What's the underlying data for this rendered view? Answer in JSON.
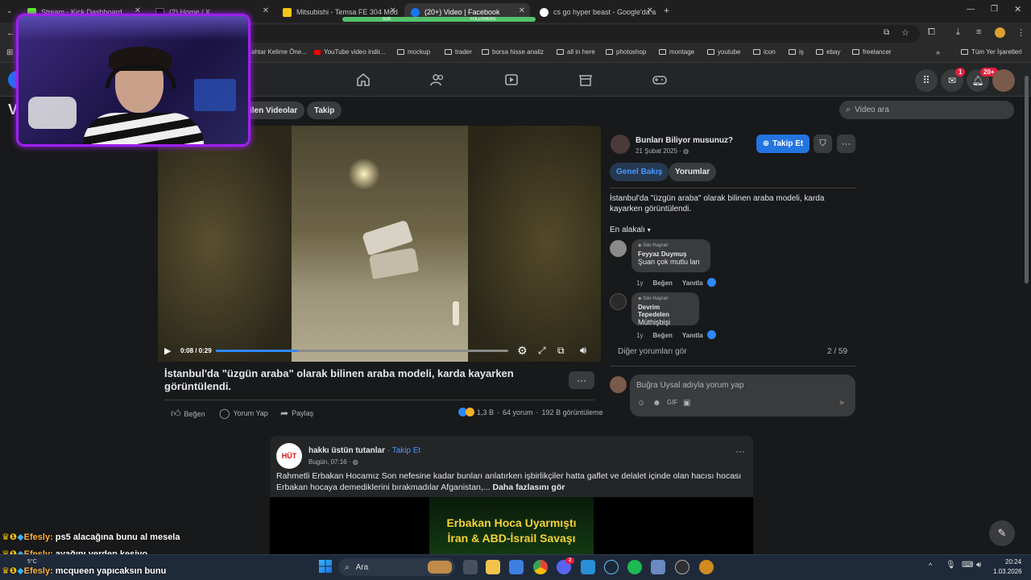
{
  "browser": {
    "tabs": [
      {
        "title": "Stream - Kick Dashboard",
        "favicon_color": "#53fc18"
      },
      {
        "title": "(2) Home / X",
        "favicon_color": "#000000"
      },
      {
        "title": "Mitsubishi - Temsa FE 304 Mod",
        "favicon_color": "#f5c518"
      },
      {
        "title": "(20+) Video | Facebook",
        "favicon_color": "#1877f2"
      },
      {
        "title": "cs go hyper beast - Google'da a",
        "favicon_color": "#ffffff"
      }
    ],
    "bookmarks": [
      "ahtar Kelime Öne...",
      "YouTube video indir...",
      "mockup",
      "trader",
      "borsa hisse analiz",
      "all in here",
      "photoshop",
      "montage",
      "youtube",
      "icon",
      "iş",
      "ebay",
      "freelancer"
    ],
    "all_bookmarks": "Tüm Yer İşaretleri",
    "overlay_bar_labels": [
      "SUB",
      "FOLLOWERS"
    ]
  },
  "fb": {
    "messenger_badge": "1",
    "notif_badge": "20+",
    "subnav": {
      "page_initial": "V",
      "chip_saved": "ilen Videolar",
      "chip_follow": "Takip"
    },
    "video_search_placeholder": "Video ara",
    "video": {
      "time": "0:08 / 0:29",
      "progress": 0.28,
      "title": "İstanbul'da \"üzgün araba\" olarak bilinen araba modeli, karda kayarken görüntülendi.",
      "more": "···",
      "like": "Beğen",
      "comment": "Yorum Yap",
      "share": "Paylaş",
      "reactions": "1,3 B",
      "comments_count": "64 yorum",
      "views": "192 B görüntüleme"
    },
    "panel": {
      "page_name": "Bunları Biliyor musunuz?",
      "date": "21 Şubat 2025 · ",
      "follow": "Takip Et",
      "tab_overview": "Genel Bakış",
      "tab_comments": "Yorumlar",
      "description": "İstanbul'da \"üzgün araba\" olarak bilinen araba modeli, karda kayarken görüntülendi.",
      "sort": "En alakalı",
      "comments": [
        {
          "badge": "Sıkı Hayran",
          "name": "Feyyaz Duymuş",
          "text": "Şuan çok mutlu lan",
          "age": "1y",
          "like": "Beğen",
          "reply": "Yanıtla"
        },
        {
          "badge": "Sıkı Hayran",
          "name": "Devrim Tepedelen",
          "text": "Müthişbişi",
          "age": "1y",
          "like": "Beğen",
          "reply": "Yanıtla"
        }
      ],
      "more_comments": "Diğer yorumları gör",
      "comment_page": "2 / 59",
      "compose_placeholder": "Buğra Uysal adıyla yorum yap"
    },
    "post": {
      "author": "hakkı üstün tutanlar",
      "follow": "Takip Et",
      "dot": " · ",
      "time": "Bugün, 07:16 · ",
      "avatar_text": "HÜT",
      "text": "Rahmetli Erbakan Hocamız Son nefesine kadar bunları anlatırken işbirlikçiler hatta gaflet ve delalet içinde olan hacısı hocası Erbakan hocaya demediklerini bırakmadılar Afganistan,... ",
      "see_more": "Daha fazlasını gör",
      "image_line1": "Erbakan Hoca Uyarmıştı",
      "image_line2": "İran & ABD-İsrail Savaşı"
    }
  },
  "chat": [
    {
      "user": "Efesly:",
      "msg": " ps5 alacağına bunu al mesela"
    },
    {
      "user": "Efesly:",
      "msg": " ayağını yerden kesiyo"
    },
    {
      "user": "Efesly:",
      "msg": " mcqueen yapıcaksın bunu"
    }
  ],
  "taskbar": {
    "search": "Ara",
    "weather": "5°C",
    "time": "20:24",
    "date": "1.03.2026",
    "chat_badge": "2"
  }
}
